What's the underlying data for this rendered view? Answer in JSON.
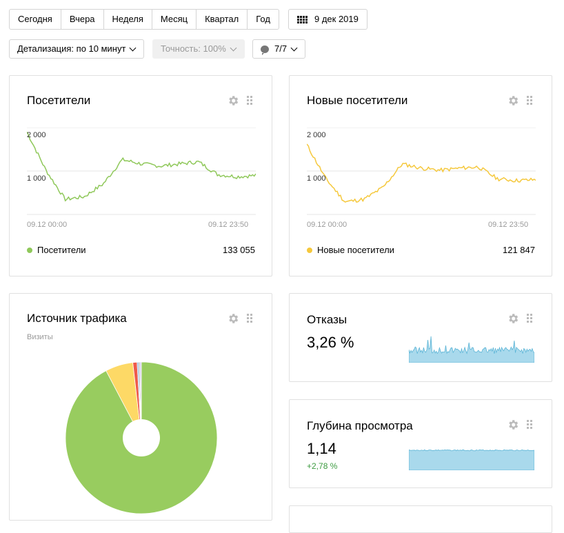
{
  "toolbar": {
    "periods": [
      "Сегодня",
      "Вчера",
      "Неделя",
      "Месяц",
      "Квартал",
      "Год"
    ],
    "date_label": "9 дек 2019",
    "detail_label": "Детализация: по 10 минут",
    "accuracy_label": "Точность: 100%",
    "segments_label": "7/7"
  },
  "visitors": {
    "title": "Посетители",
    "y_ticks": [
      "2 000",
      "1 000"
    ],
    "x_start": "09.12 00:00",
    "x_end": "09.12 23:50",
    "legend": "Посетители",
    "total": "133 055",
    "color": "#8fc85a",
    "chart_data": {
      "type": "line",
      "x": [
        "09.12 00:00",
        "09.12 02:00",
        "09.12 04:00",
        "09.12 06:00",
        "09.12 08:00",
        "09.12 10:00",
        "09.12 12:00",
        "09.12 14:00",
        "09.12 16:00",
        "09.12 18:00",
        "09.12 20:00",
        "09.12 22:00",
        "09.12 23:50"
      ],
      "values": [
        2000,
        1100,
        420,
        480,
        780,
        1350,
        1250,
        1200,
        1250,
        1300,
        1000,
        950,
        980
      ],
      "ylim": [
        0,
        2200
      ]
    }
  },
  "new_visitors": {
    "title": "Новые посетители",
    "y_ticks": [
      "2 000",
      "1 000"
    ],
    "x_start": "09.12 00:00",
    "x_end": "09.12 23:50",
    "legend": "Новые посетители",
    "total": "121 847",
    "color": "#f5c83c",
    "chart_data": {
      "type": "line",
      "x": [
        "09.12 00:00",
        "09.12 02:00",
        "09.12 04:00",
        "09.12 06:00",
        "09.12 08:00",
        "09.12 10:00",
        "09.12 12:00",
        "09.12 14:00",
        "09.12 16:00",
        "09.12 18:00",
        "09.12 20:00",
        "09.12 22:00",
        "09.12 23:50"
      ],
      "values": [
        1700,
        900,
        360,
        420,
        700,
        1250,
        1150,
        1100,
        1150,
        1180,
        900,
        860,
        880
      ],
      "ylim": [
        0,
        2200
      ]
    }
  },
  "traffic": {
    "title": "Источник трафика",
    "subtitle": "Визиты",
    "chart_data": {
      "type": "pie",
      "slices": [
        {
          "value": 92.3,
          "color": "#98cc5f"
        },
        {
          "value": 5.9,
          "color": "#fdd966"
        },
        {
          "value": 0.9,
          "color": "#ee5a4a"
        },
        {
          "value": 0.3,
          "color": "#7cb1e0"
        },
        {
          "value": 0.3,
          "color": "#b5b5b5"
        },
        {
          "value": 0.3,
          "color": "#d1c6f0"
        }
      ]
    }
  },
  "bounce": {
    "title": "Отказы",
    "value": "3,26 %",
    "color": "#a9d9ec",
    "line_color": "#5ab4d6"
  },
  "depth": {
    "title": "Глубина просмотра",
    "value": "1,14",
    "delta": "+2,78 %",
    "color": "#a9d9ec",
    "line_color": "#5ab4d6"
  }
}
